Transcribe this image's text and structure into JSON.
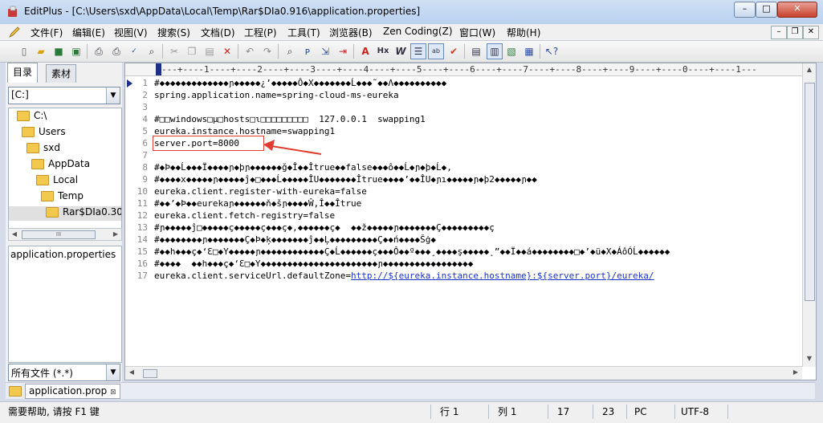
{
  "window": {
    "title": "EditPlus - [C:\\Users\\sxd\\AppData\\Local\\Temp\\Rar$DIa0.916\\application.properties]",
    "minimize": "–",
    "maximize": "□",
    "close": "✕"
  },
  "menu": {
    "items": [
      "文件(F)",
      "编辑(E)",
      "视图(V)",
      "搜索(S)",
      "文档(D)",
      "工程(P)",
      "工具(T)",
      "浏览器(B)",
      "Zen Coding(Z)",
      "窗口(W)",
      "帮助(H)"
    ],
    "mdi_minimize": "–",
    "mdi_restore": "❐",
    "mdi_close": "✕"
  },
  "toolbar": {
    "icons": [
      "new-file-icon",
      "open-folder-icon",
      "save-icon",
      "save-all-icon",
      "print-preview-icon",
      "print-icon",
      "spellcheck-icon",
      "find-in-files-icon",
      "cut-icon",
      "copy-icon",
      "paste-icon",
      "delete-icon",
      "undo-icon",
      "redo-icon",
      "find-icon",
      "replace-icon",
      "goto-icon",
      "fold-icon",
      "font-icon",
      "hex-icon",
      "word-wrap-icon",
      "line-number-icon",
      "ruler-icon",
      "check-icon",
      "document-list-icon",
      "output-icon",
      "clip-icon",
      "browser-icon",
      "help-icon"
    ]
  },
  "sidebar": {
    "tab_directory": "目录",
    "tab_clips": "素材",
    "drive": "[C:]",
    "tree": [
      "C:\\",
      "Users",
      "sxd",
      "AppData",
      "Local",
      "Temp",
      "Rar$DIa0.30("
    ],
    "scroll_thumb": "III",
    "files": [
      "application.properties"
    ],
    "filter": "所有文件 (*.*)"
  },
  "editor": {
    "ruler": "---+----1----+----2----+----3----+----4----+----5----+----6----+----7----+----8----+----9----+----0----+----1---",
    "lines": [
      {
        "no": "1",
        "text": "#◆◆◆◆◆◆◆◆◆◆◆◆◆ɲ◆◆◆◆◆¿’◆◆◆◆◆Ô◆X◆◆◆◆◆◆◆Ĺ◆◆◆˜◆◆Λ◆◆◆◆◆◆◆◆◆◆"
      },
      {
        "no": "2",
        "text": "spring.application.name=spring-cloud-ms-eureka"
      },
      {
        "no": "3",
        "text": ""
      },
      {
        "no": "4",
        "text": "#□□windows□µ□hosts□ɩ□□□□□□□□□  127.0.0.1  swapping1"
      },
      {
        "no": "5",
        "text": "eureka.instance.hostname=swapping1"
      },
      {
        "no": "6",
        "text": "server.port=8000"
      },
      {
        "no": "7",
        "text": ""
      },
      {
        "no": "8",
        "text": "#◆Þ◆◆Ĺ◆◆◆Ï◆◆◆◆ɲ◆þɲ◆◆◆◆◆◆ğ◆Î◆◆Îtrue◆◆false◆◆◆ô◆◆Ĺ◆ɲ◆þ◆Ĺ◆,"
      },
      {
        "no": "9",
        "text": "#◆◆◆◆x◆◆◆◆◆ɲ◆◆◆◆◆ĵ◆□◆◆◆Ĺ◆◆◆◆◆ÎU◆◆◆◆◆◆◆Îtrue◆◆◆◆’◆◆ÎU◆ɲı◆◆◆◆◆ɲ◆þ2◆◆◆◆◆ɲ◆◆"
      },
      {
        "no": "10",
        "text": "eureka.client.register-with-eureka=false"
      },
      {
        "no": "11",
        "text": "#◆◆’◆Þ◆◆eurekaɲ◆◆◆◆◆◆ň◆šɲ◆◆◆◆Ŵ,Î◆◆Îtrue"
      },
      {
        "no": "12",
        "text": "eureka.client.fetch-registry=false"
      },
      {
        "no": "13",
        "text": "#ɲ◆◆◆◆◆ĵ□◆◆◆◆◆ç◆◆◆◆◆ç◆◆◆ç◆,◆◆◆◆◆◆ç◆  ◆◆ž◆◆◆◆◆ɲ◆◆◆◆◆◆◆Ç◆◆◆◆◆◆◆◆◆ç"
      },
      {
        "no": "14",
        "text": "#◆◆◆◆◆◆◆◆ɲ◆◆◆◆◆◆◆Ç◆Þ◆ķ◆◆◆◆◆◆◆ĵ◆◆Ļ◆◆◆◆◆◆◆◆◆Ç◆◆ń◆◆◆◆Šġ◆"
      },
      {
        "no": "15",
        "text": "#◆◆h◆◆◆ç◆‘Ɛ□◆Y◆◆◆◆◆ɲ◆◆◆◆◆◆◆◆◆◆◆◆Ç◆Ĺ◆◆◆◆◆◆ç◆◆◆Ô◆◆º◆◆◆¸◆◆◆◆ş◆◆◆◆◆˛”◆◆Ï◆◆á◆◆◆◆◆◆◆◆□◆’◆ü◆X◆ÁôÓĹ◆◆◆◆◆◆"
      },
      {
        "no": "16",
        "text": "#◆◆◆◆  ◆◆h◆◆◆ç◆‘Ɛ□◆Y◆◆◆◆◆◆◆◆◆◆◆◆◆◆◆◆◆◆◆◆◆◆ɲ◆◆◆◆◆◆◆◆◆◆◆◆◆◆◆◆◆"
      },
      {
        "no": "17",
        "text": "eureka.client.serviceUrl.defaultZone=",
        "link": "http://${eureka.instance.hostname}:${server.port}/eureka/"
      }
    ]
  },
  "doc_tabs": {
    "active": "application.prop"
  },
  "status": {
    "help": "需要帮助, 请按 F1 键",
    "line": "行 1",
    "col": "列 1",
    "total_lines": "17",
    "total_chars": "23",
    "line_ending": "PC",
    "encoding": "UTF-8"
  },
  "colors": {
    "title_bg": "#cfe0f5",
    "link": "#1a33cc",
    "annotation_red": "#e03c31"
  }
}
